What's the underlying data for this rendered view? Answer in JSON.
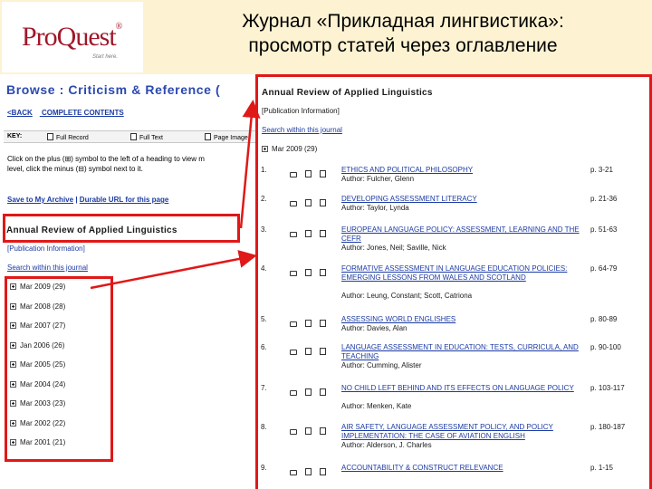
{
  "slide": {
    "title_line1": "Журнал «Прикладная лингвистика»:",
    "title_line2": "просмотр статей через оглавление"
  },
  "logo": {
    "text": "ProQuest",
    "reg": "®",
    "tagline": "Start here."
  },
  "left": {
    "browse_title": "Browse : Criticism & Reference (",
    "links": [
      "<BACK",
      "COMPLETE CONTENTS"
    ],
    "key": {
      "label": "KEY:",
      "items": [
        "Full Record",
        "Full Text",
        "Page Image"
      ]
    },
    "instructions": [
      "Click on the plus (⊞) symbol to the left of a heading to view m",
      "level, click the minus (⊟) symbol next to it."
    ],
    "save_archive": "Save to My Archive",
    "separator": "|",
    "durable_url": "Durable URL for this page",
    "journal_title": "Annual Review of Applied Linguistics",
    "pub_info": "[Publication Information]",
    "search_within": "Search within this journal",
    "issues": [
      "Mar 2009 (29)",
      "Mar 2008 (28)",
      "Mar 2007 (27)",
      "Jan 2006 (26)",
      "Mar 2005 (25)",
      "Mar 2004 (24)",
      "Mar 2003 (23)",
      "Mar 2002 (22)",
      "Mar 2001 (21)"
    ]
  },
  "right": {
    "journal_title": "Annual Review of Applied Linguistics",
    "pub_info": "[Publication Information]",
    "search_within": "Search within this journal",
    "issue": "Mar 2009 (29)",
    "articles": [
      {
        "num": "1.",
        "title": "Ethics and Political Philosophy",
        "author": "Author: Fulcher, Glenn",
        "pages": "p. 3-21"
      },
      {
        "num": "2.",
        "title": "Developing Assessment Literacy",
        "author": "Author: Taylor, Lynda",
        "pages": "p. 21-36"
      },
      {
        "num": "3.",
        "title": "European Language Policy: Assessment, Learning and the CEFR",
        "author": "Author: Jones, Neil; Saville, Nick",
        "pages": "p. 51-63"
      },
      {
        "num": "4.",
        "title": "Formative Assessment in Language Education Policies: Emerging Lessons from Wales and Scotland",
        "author": "Author: Leung, Constant; Scott, Catriona",
        "pages": "p. 64-79"
      },
      {
        "num": "5.",
        "title": "Assessing World Englishes",
        "author": "Author: Davies, Alan",
        "pages": "p. 80-89"
      },
      {
        "num": "6.",
        "title": "Language Assessment in Education: Tests, Curricula, and Teaching",
        "author": "Author: Cumming, Alister",
        "pages": "p. 90-100"
      },
      {
        "num": "7.",
        "title": "No Child Left Behind and Its Effects on Language Policy",
        "author": "Author: Menken, Kate",
        "pages": "p. 103-117"
      },
      {
        "num": "8.",
        "title": "Air Safety, Language Assessment Policy, and Policy Implementation: The Case of Aviation English",
        "author": "Author: Alderson, J. Charles",
        "pages": "p. 180-187"
      },
      {
        "num": "9.",
        "title": "Accountability & Construct Relevance",
        "author": "",
        "pages": "p. 1-15"
      }
    ]
  }
}
